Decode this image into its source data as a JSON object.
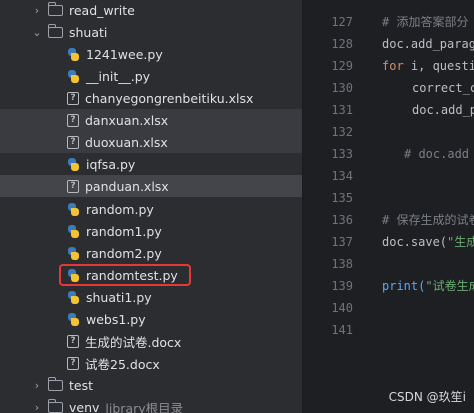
{
  "tree": {
    "read_write": "read_write",
    "shuati": "shuati",
    "files": [
      {
        "name": "1241wee.py"
      },
      {
        "name": "__init__.py"
      },
      {
        "name": "chanyegongrenbeitiku.xlsx"
      },
      {
        "name": "danxuan.xlsx"
      },
      {
        "name": "duoxuan.xlsx"
      },
      {
        "name": "iqfsa.py"
      },
      {
        "name": "panduan.xlsx"
      },
      {
        "name": "random.py"
      },
      {
        "name": "random1.py"
      },
      {
        "name": "random2.py"
      },
      {
        "name": "randomtest.py"
      },
      {
        "name": "shuati1.py"
      },
      {
        "name": "webs1.py"
      },
      {
        "name": "生成的试卷.docx"
      },
      {
        "name": "试卷25.docx"
      }
    ],
    "test": "test",
    "venv": "venv",
    "venv_hint": "library根目录"
  },
  "editor": {
    "line_numbers": [
      "127",
      "128",
      "129",
      "130",
      "131",
      "132",
      "133",
      "134",
      "135",
      "136",
      "137",
      "138",
      "139",
      "140",
      "141"
    ],
    "lines": {
      "l127_comment": "# 添加答案部分",
      "l128_text": "doc.add_parag",
      "l129_kw": "for",
      "l129_text": " i, questi",
      "l130_text": "correct_c",
      "l131_text": "doc.add_p",
      "l133_comment": "# doc.add",
      "l136_comment": "# 保存生成的试卷",
      "l137_text": "doc.save(",
      "l137_str": "\"生成",
      "l139_fn": "print(",
      "l139_str": "\"试卷生成"
    }
  },
  "watermark": "CSDN @玖笙i"
}
